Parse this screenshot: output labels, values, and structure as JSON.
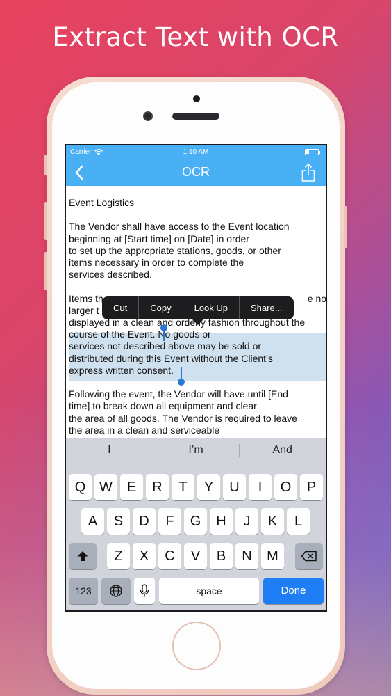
{
  "headline": "Extract Text with OCR",
  "status_bar": {
    "carrier": "Carrier",
    "time": "1:10 AM"
  },
  "nav": {
    "title": "OCR"
  },
  "document": {
    "title": "Event Logistics",
    "para1": [
      "The Vendor shall have access to the Event location",
      "beginning at [Start time] on [Date] in order",
      "to set up the appropriate stations, goods, or other",
      "items necessary in order to complete the",
      "services described."
    ],
    "para2": [
      {
        "pre": "Items th",
        "post": "e no"
      },
      {
        "pre": "larger t",
        "post": ""
      },
      {
        "pre": "displayed in a clean and orderly fashion throughout the",
        "post": ""
      },
      {
        "pre": "course of the Event. ",
        "sel": "No goods or"
      },
      {
        "sel": "services not described above may be sold or"
      },
      {
        "sel": "distributed during this Event without the Client’s"
      },
      {
        "sel": "express written consent."
      }
    ],
    "para3": [
      "Following the event, the Vendor will have until [End",
      "time] to break down all equipment and clear",
      "the area of all goods. The Vendor is required to leave",
      "the area in a clean and serviceable"
    ]
  },
  "edit_menu": [
    "Cut",
    "Copy",
    "Look Up",
    "Share..."
  ],
  "keyboard": {
    "predictions": [
      "I",
      "I’m",
      "And"
    ],
    "row1": [
      "Q",
      "W",
      "E",
      "R",
      "T",
      "Y",
      "U",
      "I",
      "O",
      "P"
    ],
    "row2": [
      "A",
      "S",
      "D",
      "F",
      "G",
      "H",
      "J",
      "K",
      "L"
    ],
    "row3": [
      "Z",
      "X",
      "C",
      "V",
      "B",
      "N",
      "M"
    ],
    "numbers_label": "123",
    "space_label": "space",
    "done_label": "Done"
  },
  "colors": {
    "accent": "#4ab0f5",
    "selection": "#cfe0ee",
    "done": "#1f7ef5"
  }
}
